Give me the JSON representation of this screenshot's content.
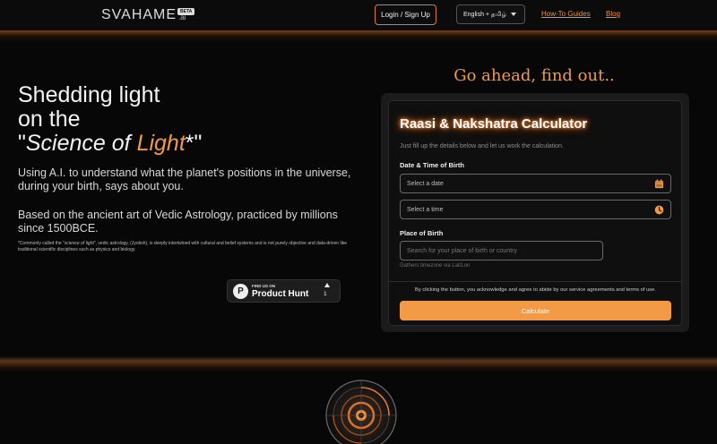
{
  "header": {
    "logo_text": "SVAHAME",
    "logo_suffix": ".ai",
    "beta_badge": "BETA",
    "login_label": "Login / Sign Up",
    "language_value": "English + தமிழ்",
    "nav_links": [
      "How-To Guides",
      "Blog"
    ]
  },
  "hero": {
    "title_line1": "Shedding light",
    "title_line2": "on the",
    "title_q1": "\"",
    "title_science": "Science of ",
    "title_light": "Light",
    "title_q2": "*\"",
    "para1": "Using A.I. to understand what the planet's positions in the universe, during your birth, says about you.",
    "para2": "Based on the ancient art of Vedic Astrology, practiced by millions since 1500BCE.",
    "footnote_prefix": "*Commonly called the \"",
    "footnote_em": "science of light",
    "footnote_rest": "\", vedic astrology, (Jyotish), is deeply intertwined with cultural and belief systems and is not purely objective and data-driven like traditional scientific disciplines such as physics and biology."
  },
  "product_hunt": {
    "small": "FIND US ON",
    "big": "Product Hunt",
    "letter": "P",
    "count": "1"
  },
  "calculator": {
    "heading": "Go ahead, find out..",
    "title": "Raasi & Nakshatra Calculator",
    "subtitle": "Just fill up the details below and let us work the calculation.",
    "datetime_label": "Date & Time of Birth",
    "date_placeholder": "Select a date",
    "time_placeholder": "Select a time",
    "place_label": "Place of Birth",
    "place_placeholder": "Search for your place of birth or country",
    "place_hint": "Gathers timezone via Lat/Lon",
    "terms": "By clicking the button, you acknowledge and agree to abide by our service agreements and terms of use.",
    "button_label": "Calculate"
  },
  "colors": {
    "accent": "#f29a46",
    "background": "#070707",
    "panel": "#1b1b1b"
  }
}
